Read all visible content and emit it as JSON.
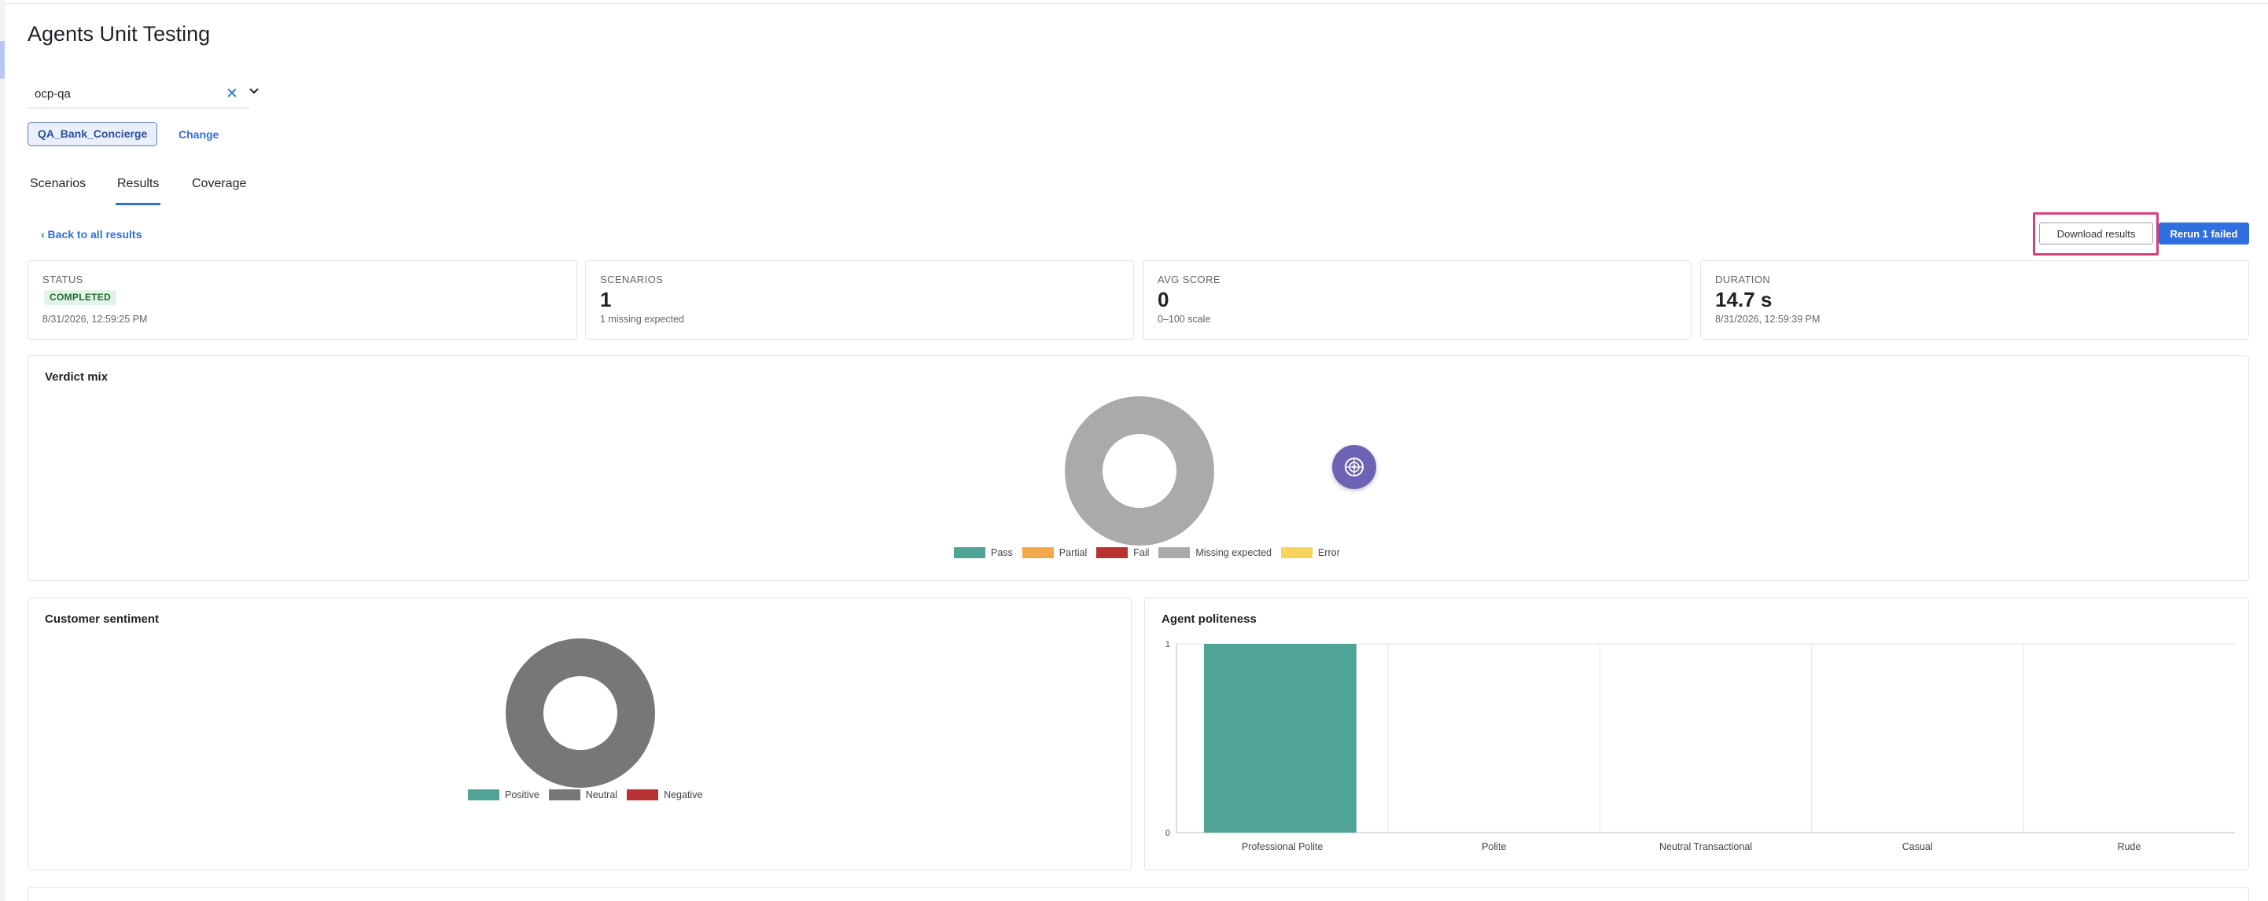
{
  "page": {
    "title": "Agents Unit Testing"
  },
  "org_select": {
    "value": "ocp-qa",
    "clear_icon": "close-icon",
    "chevron_icon": "chevron-down-icon"
  },
  "agent": {
    "chip_label": "QA_Bank_Concierge",
    "change_label": "Change"
  },
  "tabs": [
    {
      "label": "Scenarios",
      "active": false
    },
    {
      "label": "Results",
      "active": true
    },
    {
      "label": "Coverage",
      "active": false
    }
  ],
  "back_link": "‹ Back to all results",
  "toolbar": {
    "download_label": "Download results",
    "rerun_label": "Rerun 1 failed"
  },
  "stats": {
    "status": {
      "label": "STATUS",
      "badge": "COMPLETED",
      "sub": "8/31/2026, 12:59:25 PM"
    },
    "scenarios": {
      "label": "SCENARIOS",
      "value": "1",
      "sub": "1 missing expected"
    },
    "avg_score": {
      "label": "AVG SCORE",
      "value": "0",
      "sub": "0–100 scale"
    },
    "duration": {
      "label": "DURATION",
      "value": "14.7 s",
      "sub": "8/31/2026, 12:59:39 PM"
    }
  },
  "colors": {
    "accent": "#2f6fe0",
    "pass": "#4fa495",
    "partial": "#f2a84a",
    "fail": "#b83232",
    "missing_expected": "#aaaaaa",
    "error": "#f7d55a",
    "neutral": "#777777",
    "highlight": "#d63f7c"
  },
  "chart_data": [
    {
      "type": "pie",
      "title": "Verdict mix",
      "donut": true,
      "categories": [
        "Pass",
        "Partial",
        "Fail",
        "Missing expected",
        "Error"
      ],
      "values": [
        0,
        0,
        0,
        1,
        0
      ],
      "colors": [
        "#4fa495",
        "#f2a84a",
        "#b83232",
        "#aaaaaa",
        "#f7d55a"
      ],
      "legend": "bottom"
    },
    {
      "type": "pie",
      "title": "Customer sentiment",
      "donut": true,
      "categories": [
        "Positive",
        "Neutral",
        "Negative"
      ],
      "values": [
        0,
        1,
        0
      ],
      "colors": [
        "#4fa495",
        "#777777",
        "#b83232"
      ],
      "legend": "bottom"
    },
    {
      "type": "bar",
      "title": "Agent politeness",
      "categories": [
        "Professional Polite",
        "Polite",
        "Neutral Transactional",
        "Casual",
        "Rude"
      ],
      "values": [
        1,
        0,
        0,
        0,
        0
      ],
      "ylim": [
        0,
        1
      ],
      "yticks": [
        "0",
        "1"
      ],
      "color": "#4fa495",
      "grid": true
    }
  ],
  "floating_action": {
    "icon": "assistant-icon"
  }
}
